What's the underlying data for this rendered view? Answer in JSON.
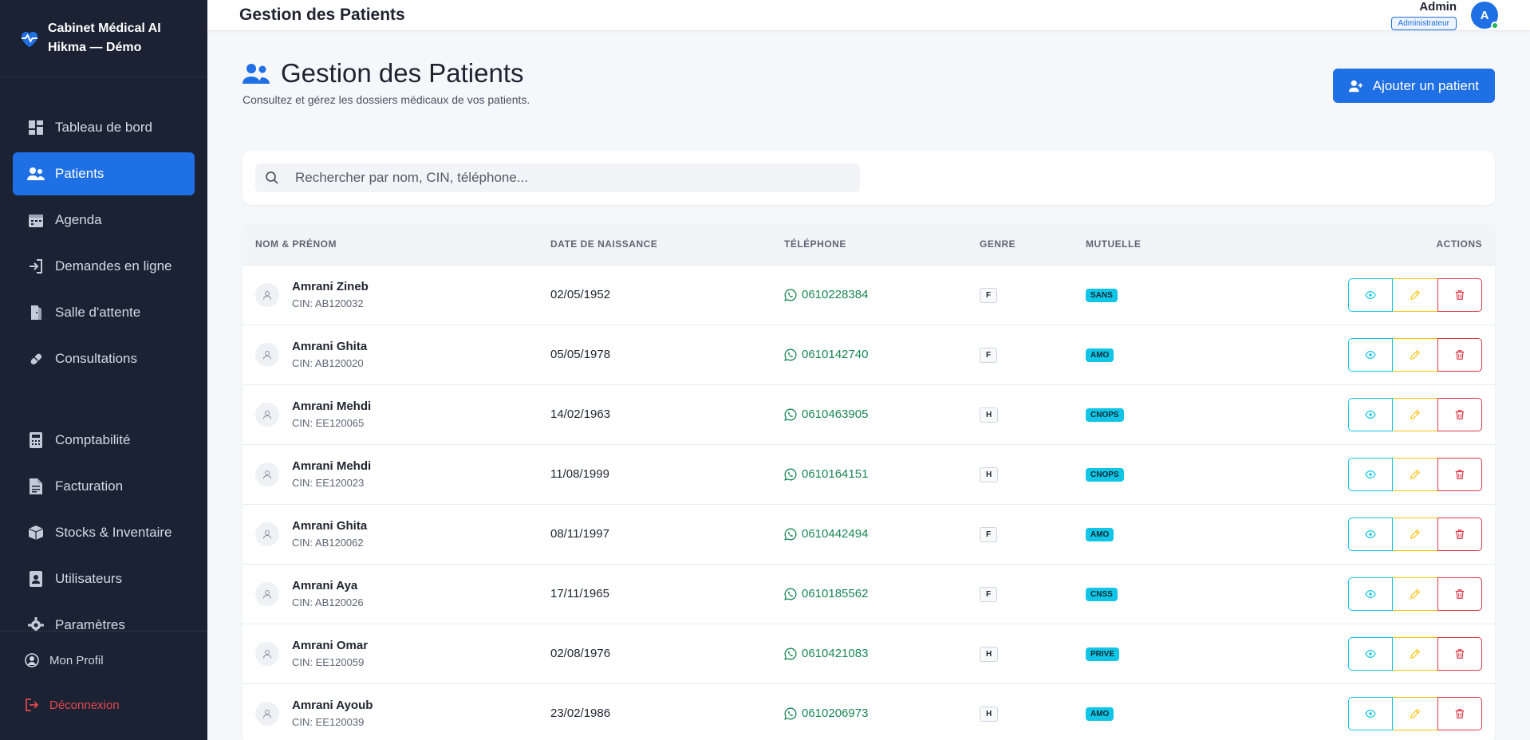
{
  "brand": {
    "title": "Cabinet Médical AI Hikma — Démo"
  },
  "sidebar": {
    "items": [
      {
        "label": "Tableau de bord",
        "icon": "dashboard-icon"
      },
      {
        "label": "Patients",
        "icon": "users-icon",
        "active": true
      },
      {
        "label": "Agenda",
        "icon": "calendar-icon"
      },
      {
        "label": "Demandes en ligne",
        "icon": "sign-in-icon"
      },
      {
        "label": "Salle d'attente",
        "icon": "door-icon"
      },
      {
        "label": "Consultations",
        "icon": "pills-icon"
      }
    ],
    "items2": [
      {
        "label": "Comptabilité",
        "icon": "calculator-icon"
      },
      {
        "label": "Facturation",
        "icon": "invoice-icon"
      },
      {
        "label": "Stocks & Inventaire",
        "icon": "box-icon"
      },
      {
        "label": "Utilisateurs",
        "icon": "user-badge-icon"
      },
      {
        "label": "Paramètres",
        "icon": "gear-icon"
      }
    ],
    "profile": "Mon Profil",
    "logout": "Déconnexion"
  },
  "topbar": {
    "title": "Gestion des Patients",
    "user_name": "Admin",
    "role": "Administrateur",
    "avatar_initial": "A"
  },
  "page": {
    "title": "Gestion des Patients",
    "subtitle": "Consultez et gérez les dossiers médicaux de vos patients.",
    "add_button": "Ajouter un patient",
    "search_placeholder": "Rechercher par nom, CIN, téléphone..."
  },
  "table": {
    "headers": {
      "name": "NOM & PRÉNOM",
      "birth": "DATE DE NAISSANCE",
      "phone": "TÉLÉPHONE",
      "genre": "GENRE",
      "mutuelle": "MUTUELLE",
      "actions": "ACTIONS"
    },
    "rows": [
      {
        "name": "Amrani Zineb",
        "cin": "CIN: AB120032",
        "birth": "02/05/1952",
        "phone": "0610228384",
        "genre": "F",
        "mutuelle": "SANS"
      },
      {
        "name": "Amrani Ghita",
        "cin": "CIN: AB120020",
        "birth": "05/05/1978",
        "phone": "0610142740",
        "genre": "F",
        "mutuelle": "AMO"
      },
      {
        "name": "Amrani Mehdi",
        "cin": "CIN: EE120065",
        "birth": "14/02/1963",
        "phone": "0610463905",
        "genre": "H",
        "mutuelle": "CNOPS"
      },
      {
        "name": "Amrani Mehdi",
        "cin": "CIN: EE120023",
        "birth": "11/08/1999",
        "phone": "0610164151",
        "genre": "H",
        "mutuelle": "CNOPS"
      },
      {
        "name": "Amrani Ghita",
        "cin": "CIN: AB120062",
        "birth": "08/11/1997",
        "phone": "0610442494",
        "genre": "F",
        "mutuelle": "AMO"
      },
      {
        "name": "Amrani Aya",
        "cin": "CIN: AB120026",
        "birth": "17/11/1965",
        "phone": "0610185562",
        "genre": "F",
        "mutuelle": "CNSS"
      },
      {
        "name": "Amrani Omar",
        "cin": "CIN: EE120059",
        "birth": "02/08/1976",
        "phone": "0610421083",
        "genre": "H",
        "mutuelle": "PRIVE"
      },
      {
        "name": "Amrani Ayoub",
        "cin": "CIN: EE120039",
        "birth": "23/02/1986",
        "phone": "0610206973",
        "genre": "H",
        "mutuelle": "AMO"
      }
    ]
  },
  "colors": {
    "primary": "#1f6fe5",
    "sidebar": "#1a2233",
    "phone": "#198754",
    "info": "#11c5e6",
    "warning": "#ffc107",
    "danger": "#dc3545"
  }
}
